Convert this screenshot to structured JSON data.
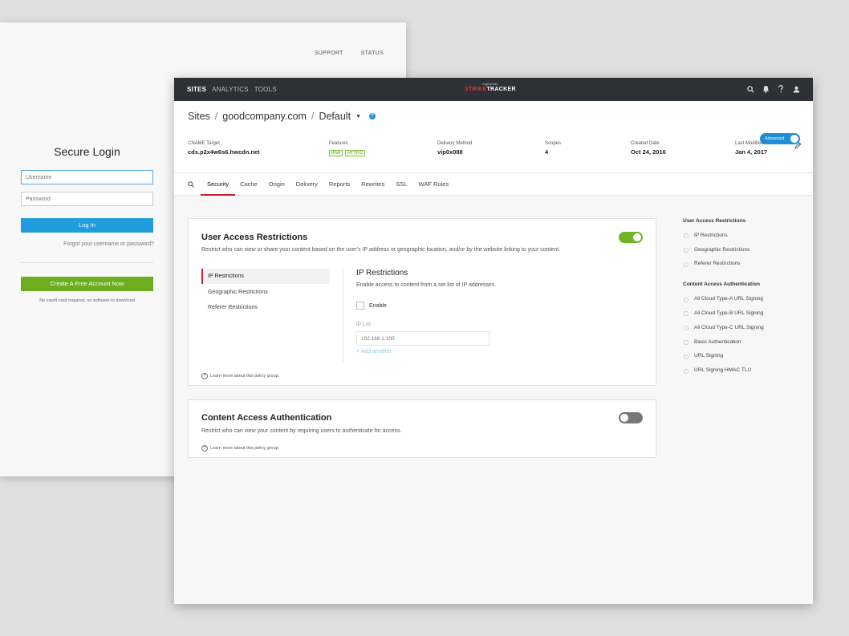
{
  "login": {
    "topnav": [
      "SUPPORT",
      "STATUS"
    ],
    "title": "Secure Login",
    "username_placeholder": "Username",
    "password_placeholder": "Password",
    "login_label": "Log In",
    "forgot_label": "Forgot your username or password?",
    "create_label": "Create A Free Account Now",
    "note": "No credit card required, no software to download"
  },
  "topbar": {
    "nav": [
      "SITES",
      "ANALYTICS",
      "TOOLS"
    ],
    "active_nav": "SITES",
    "brand_small": "highwinds",
    "brand_strike": "STRIKE",
    "brand_tracker": "TRACKER",
    "icons": [
      "search-icon",
      "bell-icon",
      "help-icon",
      "user-icon"
    ]
  },
  "header": {
    "crumbs": [
      "Sites",
      "goodcompany.com",
      "Default"
    ],
    "advanced_label": "Advanced",
    "meta": [
      {
        "label": "CNAME Target",
        "value": "cds.p2x4w6s6.hwcdn.net"
      },
      {
        "label": "Features",
        "badges": [
          "IPv6",
          "HTTP/2"
        ]
      },
      {
        "label": "Delivery Method",
        "value": "vip0x088"
      },
      {
        "label": "Scopes",
        "value": "4"
      },
      {
        "label": "Created Date",
        "value": "Oct 24, 2016"
      },
      {
        "label": "Last Modified",
        "value": "Jan 4, 2017"
      }
    ]
  },
  "tabs": [
    "Security",
    "Cache",
    "Origin",
    "Delivery",
    "Reports",
    "Rewrites",
    "SSL",
    "WAF Rules"
  ],
  "active_tab": "Security",
  "uar": {
    "title": "User Access Restrictions",
    "desc": "Restrict who can view or share your content based on the user's IP address or geographic location, and/or by the website linking to your content.",
    "subnav": [
      "IP Restrictions",
      "Geographic Restrictions",
      "Referer Restrictions"
    ],
    "detail_title": "IP Restrictions",
    "detail_desc": "Enable access to content from a set list of IP addresses.",
    "enable_label": "Enable",
    "ip_list_label": "IP List",
    "ip_placeholder": "192.168.1.100",
    "add_another": "+ Add another",
    "learn_more": "Learn more about this policy group."
  },
  "caa": {
    "title": "Content Access Authentication",
    "desc": "Restrict who can view your content by requiring users to authenticate for access.",
    "learn_more": "Learn more about this policy group."
  },
  "outline": {
    "group1_title": "User Access Restrictions",
    "group1_items": [
      "IP Restrictions",
      "Geographic Restrictions",
      "Referer Restrictions"
    ],
    "group2_title": "Content Access Authentication",
    "group2_items": [
      "Ali Cloud Type-A URL Signing",
      "Ali Cloud Type-B URL Signing",
      "Ali Cloud Type-C URL Signing",
      "Basic Authentication",
      "URL Signing",
      "URL Signing HMAC TLU"
    ]
  },
  "colors": {
    "topbar": "#2d3035",
    "accent_red": "#c8232c",
    "accent_blue": "#1f8ed8",
    "toggle_on": "#72b324",
    "create_green": "#6cae1d"
  }
}
